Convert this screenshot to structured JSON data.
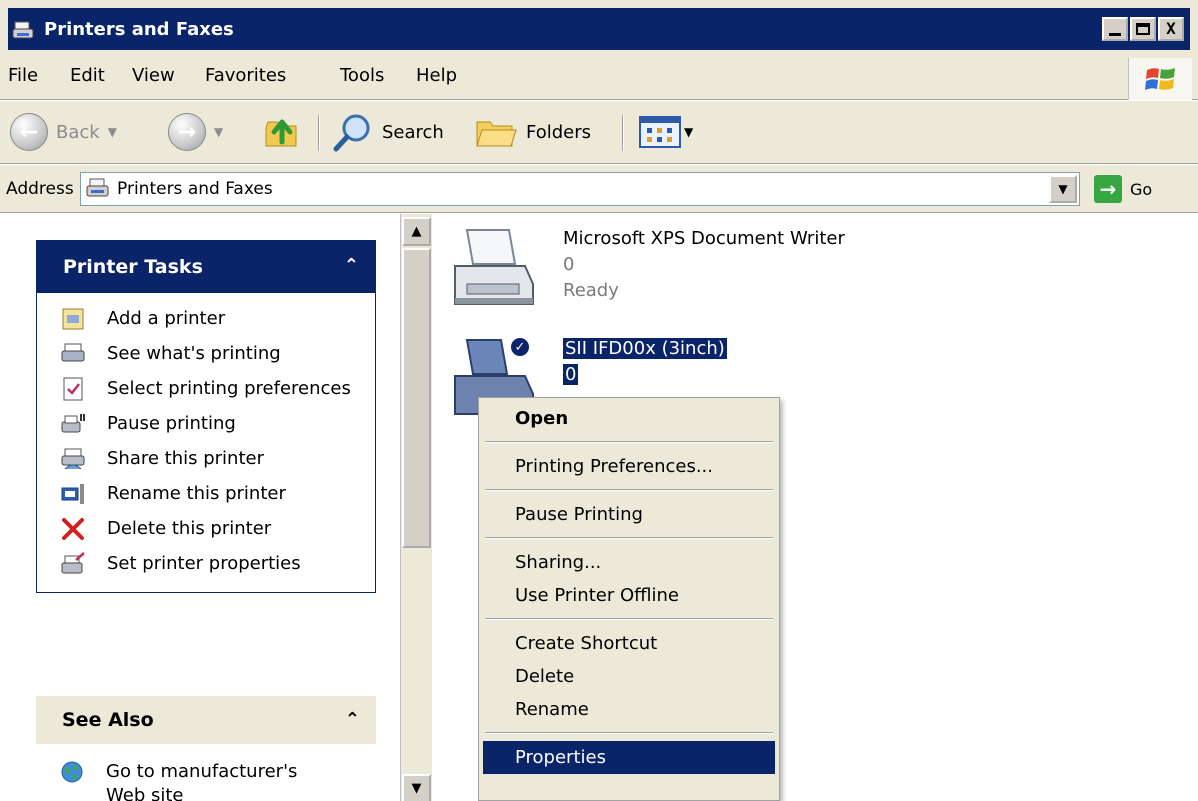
{
  "window": {
    "title": "Printers and Faxes",
    "controls": {
      "minimize": "_",
      "maximize": "□",
      "close": "X"
    }
  },
  "menu": [
    "File",
    "Edit",
    "View",
    "Favorites",
    "Tools",
    "Help"
  ],
  "toolbar": {
    "back_label": "Back",
    "search_label": "Search",
    "folders_label": "Folders"
  },
  "address": {
    "label": "Address",
    "value": "Printers and Faxes",
    "go_label": "Go"
  },
  "printer_tasks": {
    "title": "Printer Tasks",
    "items": [
      {
        "label": "Add a printer",
        "icon": "add-printer-icon"
      },
      {
        "label": "See what's printing",
        "icon": "print-queue-icon"
      },
      {
        "label": "Select printing preferences",
        "icon": "preferences-icon"
      },
      {
        "label": "Pause printing",
        "icon": "pause-printer-icon"
      },
      {
        "label": "Share this printer",
        "icon": "share-printer-icon"
      },
      {
        "label": "Rename this printer",
        "icon": "rename-icon"
      },
      {
        "label": "Delete this printer",
        "icon": "delete-icon"
      },
      {
        "label": "Set printer properties",
        "icon": "properties-icon"
      }
    ]
  },
  "see_also": {
    "title": "See Also",
    "items": [
      {
        "label": "Go to manufacturer's Web site",
        "icon": "globe-icon"
      }
    ]
  },
  "printers": [
    {
      "name": "Microsoft XPS Document Writer",
      "jobs": "0",
      "status": "Ready",
      "selected": false
    },
    {
      "name": "SII IFD00x (3inch)",
      "jobs": "0",
      "selected": true,
      "default": true
    }
  ],
  "context_menu": {
    "groups": [
      [
        "Open"
      ],
      [
        "Printing Preferences..."
      ],
      [
        "Pause Printing"
      ],
      [
        "Sharing...",
        "Use Printer Offline"
      ],
      [
        "Create Shortcut",
        "Delete",
        "Rename"
      ],
      [
        "Properties"
      ]
    ],
    "highlighted": "Properties",
    "default_item": "Open"
  },
  "colors": {
    "titlebar": "#0a246a",
    "selection": "#0a246a",
    "chrome": "#ece9d8"
  }
}
